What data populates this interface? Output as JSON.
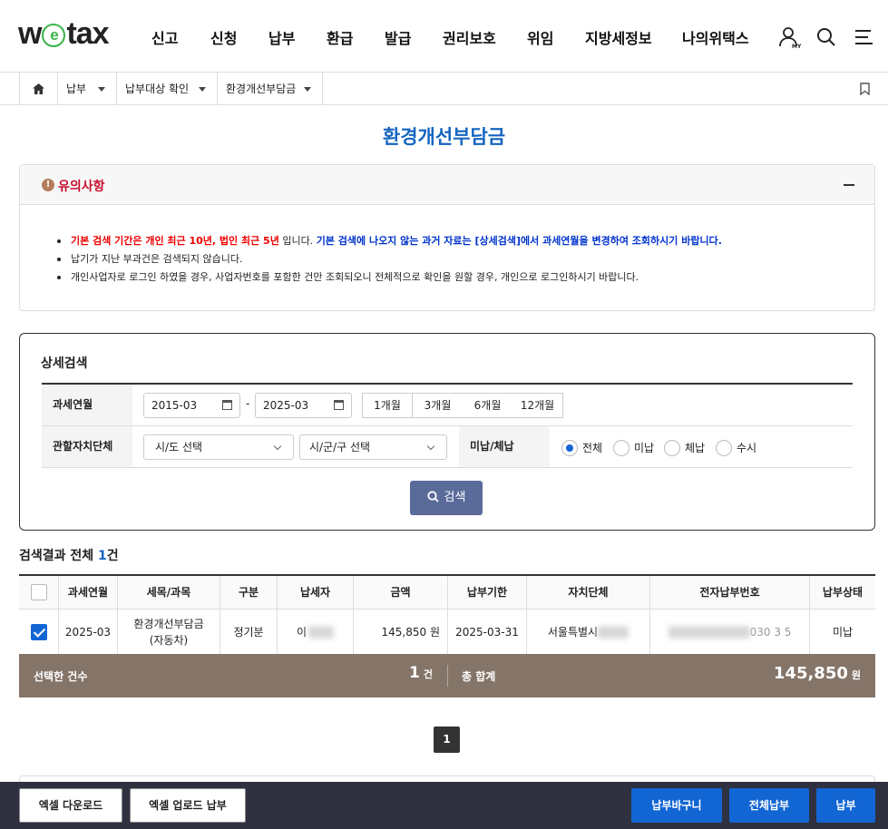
{
  "header": {
    "logo_left": "w",
    "logo_e": "e",
    "logo_right": "tax",
    "nav": [
      "신고",
      "신청",
      "납부",
      "환급",
      "발급",
      "권리보호",
      "위임",
      "지방세정보",
      "나의위택스"
    ],
    "my_label": "MY"
  },
  "breadcrumb": {
    "items": [
      "납부",
      "납부대상 확인",
      "환경개선부담금"
    ]
  },
  "page_title": "환경개선부담금",
  "notice": {
    "title": "유의사항",
    "warn_glyph": "!",
    "line1_red": "기본 검색 기간은 개인 최근 10년, 법인 최근 5년",
    "line1_mid": " 입니다. ",
    "line1_blue": "기본 검색에 나오지 않는 과거 자료는 [상세검색]에서 과세연월을 변경하여 조회하시기 바랍니다.",
    "line2": "납기가 지난 부과건은 검색되지 않습니다.",
    "line3": "개인사업자로 로그인 하였을 경우, 사업자번호를 포함한 건만 조회되오니 전체적으로 확인을 원할 경우, 개인으로 로그인하시기 바랍니다."
  },
  "search": {
    "heading": "상세검색",
    "period_label": "과세연월",
    "from": "2015-03",
    "dash": "-",
    "to": "2025-03",
    "periods": [
      "1개월",
      "3개월",
      "6개월",
      "12개월"
    ],
    "region_label": "관할자치단체",
    "sido_placeholder": "시/도 선택",
    "sigungu_placeholder": "시/군/구 선택",
    "status_label": "미납/체납",
    "status_options": [
      "전체",
      "미납",
      "체납",
      "수시"
    ],
    "status_selected": "전체",
    "search_button": "검색"
  },
  "results": {
    "prefix": "검색결과 전체 ",
    "count": "1",
    "suffix": "건",
    "columns": [
      "과세연월",
      "세목/과목",
      "구분",
      "납세자",
      "금액",
      "납부기한",
      "자치단체",
      "전자납부번호",
      "납부상태"
    ],
    "rows": [
      {
        "checked": true,
        "period": "2025-03",
        "tax_line1": "환경개선부담금",
        "tax_line2": "(자동차)",
        "type": "정기분",
        "payer": "이",
        "amount": "145,850 원",
        "due": "2025-03-31",
        "region": "서울특별시",
        "epay_tail": "030 3 5",
        "status": "미납"
      }
    ]
  },
  "summary": {
    "selected_label": "선택한 건수",
    "selected_count": "1",
    "count_unit": "건",
    "total_label": "총 합계",
    "total_amount": "145,850",
    "won": "원"
  },
  "pagination": {
    "current": "1"
  },
  "footer": {
    "excel_download": "엑셀 다운로드",
    "excel_upload": "엑셀 업로드 납부",
    "basket": "납부바구니",
    "pay_all": "전체납부",
    "pay": "납부"
  },
  "colors": {
    "accent": "#1266d4",
    "title": "#1565c0",
    "summary_bg": "#857569",
    "footer_bg": "#2f3140",
    "search_btn": "#5a6b9a"
  }
}
